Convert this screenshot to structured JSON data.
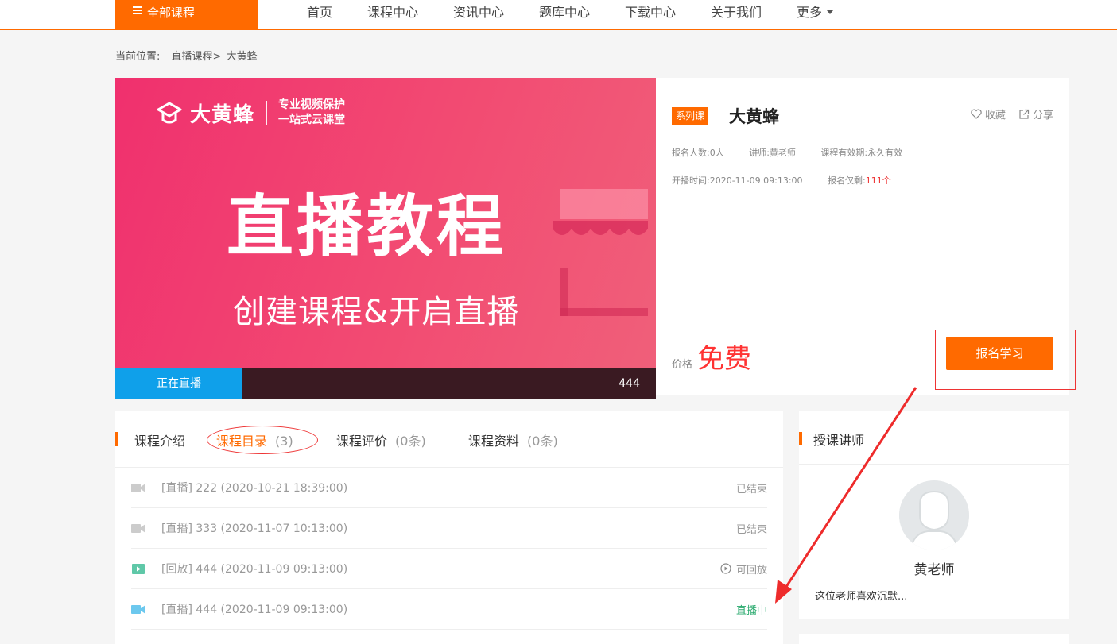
{
  "nav": {
    "all_courses": "全部课程",
    "items": [
      "首页",
      "课程中心",
      "资讯中心",
      "题库中心",
      "下载中心",
      "关于我们",
      "更多"
    ]
  },
  "breadcrumb": {
    "label": "当前位置:",
    "path1": "直播课程>",
    "path2": "大黄蜂"
  },
  "banner": {
    "logo_name": "大黄蜂",
    "logo_tag1": "专业视频保护",
    "logo_tag2": "一站式云课堂",
    "headline": "直播教程",
    "subline": "创建课程&开启直播",
    "live_badge": "正在直播",
    "live_count": "444"
  },
  "course": {
    "series_badge": "系列课",
    "title": "大黄蜂",
    "favorite": "收藏",
    "share": "分享",
    "enrolled": "报名人数:0人",
    "teacher": "讲师:黄老师",
    "validity": "课程有效期:永久有效",
    "start_time": "开播时间:2020-11-09 09:13:00",
    "remaining_label": "报名仅剩:",
    "remaining": "111个",
    "price_label": "价格",
    "price": "免费",
    "enroll_button": "报名学习"
  },
  "tabs": [
    {
      "label": "课程介绍",
      "count": ""
    },
    {
      "label": "课程目录",
      "count": "(3)"
    },
    {
      "label": "课程评价",
      "count": "(0条)"
    },
    {
      "label": "课程资料",
      "count": "(0条)"
    }
  ],
  "lessons": [
    {
      "text": "[直播]  222 (2020-10-21 18:39:00)",
      "status": "已结束",
      "kind": "camera-gray"
    },
    {
      "text": "[直播]  333 (2020-11-07 10:13:00)",
      "status": "已结束",
      "kind": "camera-gray"
    },
    {
      "text": "[回放]  444 (2020-11-09 09:13:00)",
      "status": "可回放",
      "kind": "play-green"
    },
    {
      "text": "[直播]  444 (2020-11-09 09:13:00)",
      "status": "直播中",
      "kind": "camera-blue"
    }
  ],
  "teacher_card": {
    "header": "授课讲师",
    "name": "黄老师",
    "desc": "这位老师喜欢沉默..."
  },
  "colors": {
    "accent": "#ff6a00",
    "live_blue": "#0fa0ea",
    "price_red": "#ff3333",
    "live_green": "#2aaa6e"
  }
}
